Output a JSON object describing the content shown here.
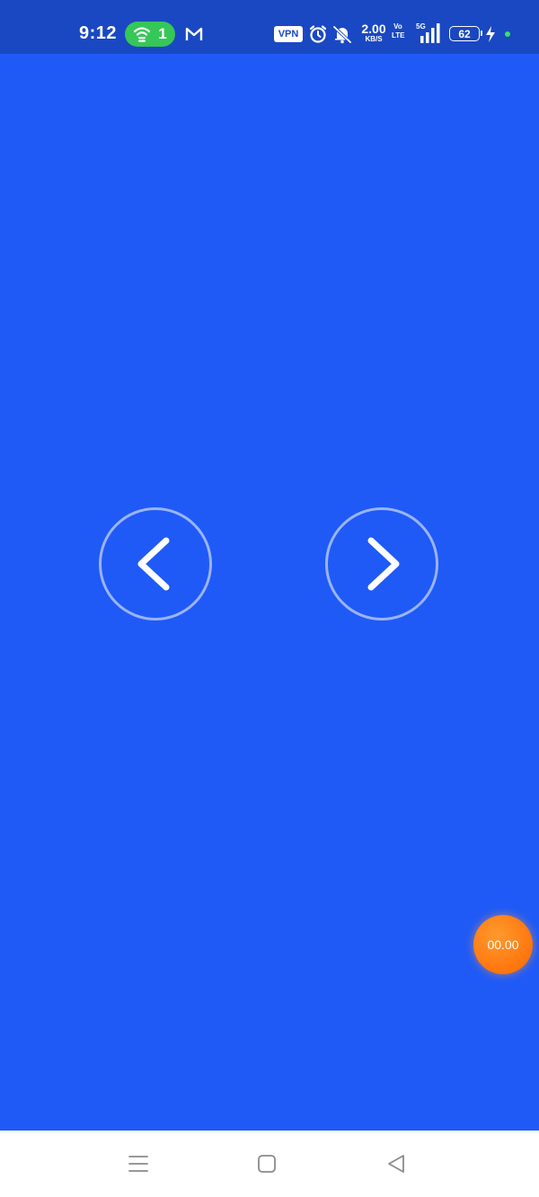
{
  "status_bar": {
    "time": "9:12",
    "hotspot_count": "1",
    "vpn_label": "VPN",
    "net_speed_value": "2.00",
    "net_speed_unit": "KB/S",
    "volte_top": "Vo",
    "volte_bottom": "LTE",
    "network_type": "5G",
    "battery_level": "62",
    "icons": [
      "hotspot-icon",
      "gmail-icon",
      "alarm-icon",
      "mute-icon",
      "signal-icon",
      "charging-icon"
    ]
  },
  "main": {
    "background_color": "#1f5af7",
    "prev_icon": "chevron-left-icon",
    "next_icon": "chevron-right-icon",
    "timer_text": "00.00",
    "timer_color": "#ff7a12"
  },
  "system_nav": {
    "icons": [
      "menu-icon",
      "home-icon",
      "back-icon"
    ]
  }
}
